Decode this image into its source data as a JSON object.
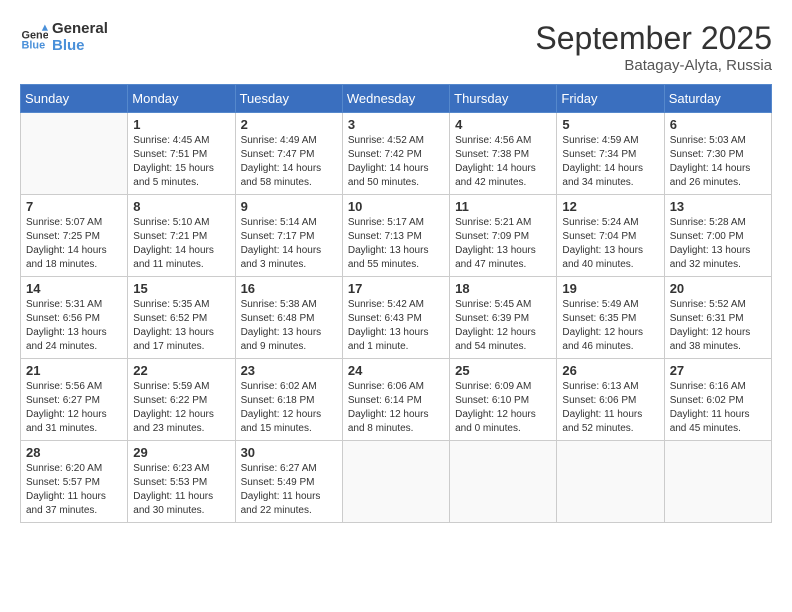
{
  "logo": {
    "line1": "General",
    "line2": "Blue"
  },
  "title": "September 2025",
  "subtitle": "Batagay-Alyta, Russia",
  "days_of_week": [
    "Sunday",
    "Monday",
    "Tuesday",
    "Wednesday",
    "Thursday",
    "Friday",
    "Saturday"
  ],
  "weeks": [
    [
      {
        "day": "",
        "info": ""
      },
      {
        "day": "1",
        "info": "Sunrise: 4:45 AM\nSunset: 7:51 PM\nDaylight: 15 hours\nand 5 minutes."
      },
      {
        "day": "2",
        "info": "Sunrise: 4:49 AM\nSunset: 7:47 PM\nDaylight: 14 hours\nand 58 minutes."
      },
      {
        "day": "3",
        "info": "Sunrise: 4:52 AM\nSunset: 7:42 PM\nDaylight: 14 hours\nand 50 minutes."
      },
      {
        "day": "4",
        "info": "Sunrise: 4:56 AM\nSunset: 7:38 PM\nDaylight: 14 hours\nand 42 minutes."
      },
      {
        "day": "5",
        "info": "Sunrise: 4:59 AM\nSunset: 7:34 PM\nDaylight: 14 hours\nand 34 minutes."
      },
      {
        "day": "6",
        "info": "Sunrise: 5:03 AM\nSunset: 7:30 PM\nDaylight: 14 hours\nand 26 minutes."
      }
    ],
    [
      {
        "day": "7",
        "info": "Sunrise: 5:07 AM\nSunset: 7:25 PM\nDaylight: 14 hours\nand 18 minutes."
      },
      {
        "day": "8",
        "info": "Sunrise: 5:10 AM\nSunset: 7:21 PM\nDaylight: 14 hours\nand 11 minutes."
      },
      {
        "day": "9",
        "info": "Sunrise: 5:14 AM\nSunset: 7:17 PM\nDaylight: 14 hours\nand 3 minutes."
      },
      {
        "day": "10",
        "info": "Sunrise: 5:17 AM\nSunset: 7:13 PM\nDaylight: 13 hours\nand 55 minutes."
      },
      {
        "day": "11",
        "info": "Sunrise: 5:21 AM\nSunset: 7:09 PM\nDaylight: 13 hours\nand 47 minutes."
      },
      {
        "day": "12",
        "info": "Sunrise: 5:24 AM\nSunset: 7:04 PM\nDaylight: 13 hours\nand 40 minutes."
      },
      {
        "day": "13",
        "info": "Sunrise: 5:28 AM\nSunset: 7:00 PM\nDaylight: 13 hours\nand 32 minutes."
      }
    ],
    [
      {
        "day": "14",
        "info": "Sunrise: 5:31 AM\nSunset: 6:56 PM\nDaylight: 13 hours\nand 24 minutes."
      },
      {
        "day": "15",
        "info": "Sunrise: 5:35 AM\nSunset: 6:52 PM\nDaylight: 13 hours\nand 17 minutes."
      },
      {
        "day": "16",
        "info": "Sunrise: 5:38 AM\nSunset: 6:48 PM\nDaylight: 13 hours\nand 9 minutes."
      },
      {
        "day": "17",
        "info": "Sunrise: 5:42 AM\nSunset: 6:43 PM\nDaylight: 13 hours\nand 1 minute."
      },
      {
        "day": "18",
        "info": "Sunrise: 5:45 AM\nSunset: 6:39 PM\nDaylight: 12 hours\nand 54 minutes."
      },
      {
        "day": "19",
        "info": "Sunrise: 5:49 AM\nSunset: 6:35 PM\nDaylight: 12 hours\nand 46 minutes."
      },
      {
        "day": "20",
        "info": "Sunrise: 5:52 AM\nSunset: 6:31 PM\nDaylight: 12 hours\nand 38 minutes."
      }
    ],
    [
      {
        "day": "21",
        "info": "Sunrise: 5:56 AM\nSunset: 6:27 PM\nDaylight: 12 hours\nand 31 minutes."
      },
      {
        "day": "22",
        "info": "Sunrise: 5:59 AM\nSunset: 6:22 PM\nDaylight: 12 hours\nand 23 minutes."
      },
      {
        "day": "23",
        "info": "Sunrise: 6:02 AM\nSunset: 6:18 PM\nDaylight: 12 hours\nand 15 minutes."
      },
      {
        "day": "24",
        "info": "Sunrise: 6:06 AM\nSunset: 6:14 PM\nDaylight: 12 hours\nand 8 minutes."
      },
      {
        "day": "25",
        "info": "Sunrise: 6:09 AM\nSunset: 6:10 PM\nDaylight: 12 hours\nand 0 minutes."
      },
      {
        "day": "26",
        "info": "Sunrise: 6:13 AM\nSunset: 6:06 PM\nDaylight: 11 hours\nand 52 minutes."
      },
      {
        "day": "27",
        "info": "Sunrise: 6:16 AM\nSunset: 6:02 PM\nDaylight: 11 hours\nand 45 minutes."
      }
    ],
    [
      {
        "day": "28",
        "info": "Sunrise: 6:20 AM\nSunset: 5:57 PM\nDaylight: 11 hours\nand 37 minutes."
      },
      {
        "day": "29",
        "info": "Sunrise: 6:23 AM\nSunset: 5:53 PM\nDaylight: 11 hours\nand 30 minutes."
      },
      {
        "day": "30",
        "info": "Sunrise: 6:27 AM\nSunset: 5:49 PM\nDaylight: 11 hours\nand 22 minutes."
      },
      {
        "day": "",
        "info": ""
      },
      {
        "day": "",
        "info": ""
      },
      {
        "day": "",
        "info": ""
      },
      {
        "day": "",
        "info": ""
      }
    ]
  ]
}
